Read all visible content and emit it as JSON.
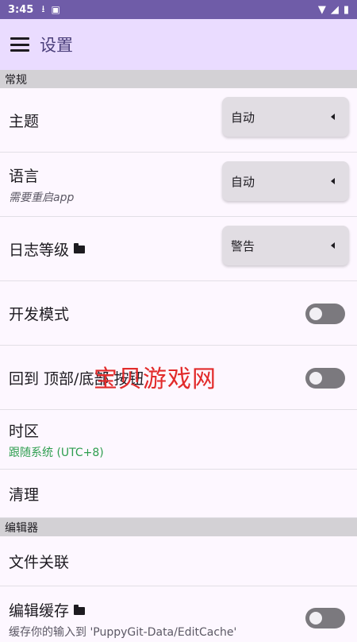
{
  "status_bar": {
    "time": "3:45",
    "icons": [
      "download-icon",
      "a-icon",
      "wifi-icon",
      "signal-icon",
      "battery-icon"
    ]
  },
  "app_bar": {
    "title": "设置"
  },
  "sections": {
    "general": "常规",
    "editor": "编辑器"
  },
  "settings": {
    "theme": {
      "label": "主题",
      "value": "自动"
    },
    "language": {
      "label": "语言",
      "subtitle": "需要重启app",
      "value": "自动"
    },
    "log_level": {
      "label": "日志等级",
      "value": "警告"
    },
    "dev_mode": {
      "label": "开发模式",
      "enabled": false
    },
    "go_top_bottom": {
      "label": "回到 顶部/底部 按钮",
      "enabled": false
    },
    "timezone": {
      "label": "时区",
      "subtitle": "跟随系统 (UTC+8)"
    },
    "clean": {
      "label": "清理"
    },
    "file_assoc": {
      "label": "文件关联"
    },
    "edit_cache": {
      "label": "编辑缓存",
      "subtitle": "缓存你的输入到 'PuppyGit-Data/EditCache'",
      "enabled": false
    }
  },
  "watermark": "宝贝游戏网",
  "colors": {
    "status_bar": "#6f5ca8",
    "app_bar": "#eadcff",
    "section_header": "#d3d1d5",
    "green_subtitle": "#2e9e4f",
    "watermark": "#e22b2b"
  }
}
